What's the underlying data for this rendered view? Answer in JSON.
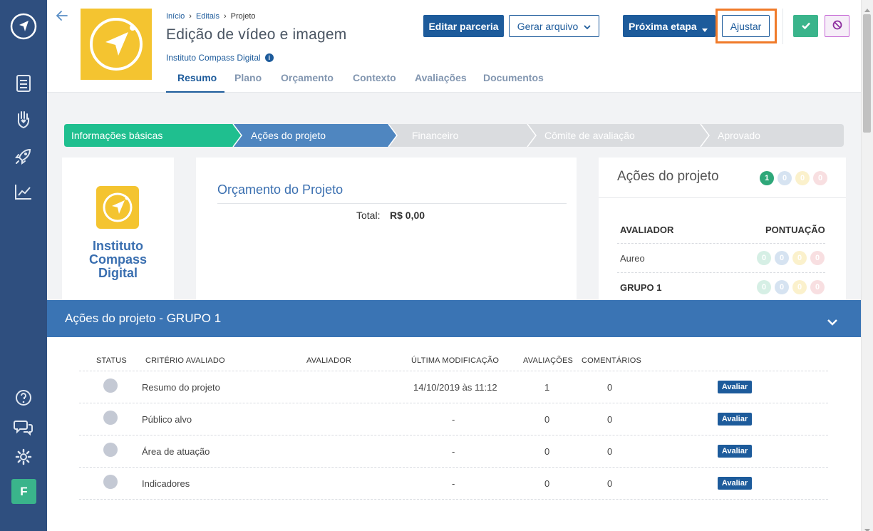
{
  "breadcrumb": {
    "home": "Início",
    "editais": "Editais",
    "current": "Projeto"
  },
  "sep": "›",
  "header": {
    "title": "Edição de vídeo e imagem",
    "organization": "Instituto Compass Digital",
    "info_icon": "info-icon",
    "back_icon": "arrow-left-icon"
  },
  "buttons": {
    "editar_parceria": "Editar parceria",
    "gerar_arquivo": "Gerar arquivo",
    "proxima_etapa": "Próxima etapa",
    "ajustar": "Ajustar"
  },
  "tabs": [
    "Resumo",
    "Plano",
    "Orçamento",
    "Contexto",
    "Avaliações",
    "Documentos"
  ],
  "steps": [
    "Informações básicas",
    "Ações do projeto",
    "Financeiro",
    "Cômite de avaliação",
    "Aprovado"
  ],
  "org_card": {
    "name_line1": "Instituto",
    "name_line2": "Compass",
    "name_line3": "Digital"
  },
  "budget": {
    "title": "Orçamento do Projeto",
    "total_label": "Total:",
    "total_value": "R$ 0,00"
  },
  "actions_card": {
    "title": "Ações do projeto",
    "badges": [
      "1",
      "0",
      "0",
      "0"
    ],
    "col_evaluator": "AVALIADOR",
    "col_score": "PONTUAÇÃO",
    "rows": [
      {
        "name": "Aureo",
        "scores": [
          "0",
          "0",
          "0",
          "0"
        ]
      },
      {
        "name": "GRUPO 1",
        "scores": [
          "0",
          "0",
          "0",
          "0"
        ]
      }
    ]
  },
  "group_panel": {
    "title": "Ações do projeto - GRUPO 1",
    "columns": [
      "STATUS",
      "CRITÉRIO AVALIADO",
      "AVALIADOR",
      "ÚLTIMA MODIFICAÇÃO",
      "AVALIAÇÕES",
      "COMENTÁRIOS"
    ],
    "action_label": "Avaliar",
    "rows": [
      {
        "criterion": "Resumo do projeto",
        "evaluator": "",
        "modified": "14/10/2019 às 11:12",
        "evaluations": "1",
        "comments": "0"
      },
      {
        "criterion": "Público alvo",
        "evaluator": "",
        "modified": "-",
        "evaluations": "0",
        "comments": "0"
      },
      {
        "criterion": "Área de atuação",
        "evaluator": "",
        "modified": "-",
        "evaluations": "0",
        "comments": "0"
      },
      {
        "criterion": "Indicadores",
        "evaluator": "",
        "modified": "-",
        "evaluations": "0",
        "comments": "0"
      }
    ]
  },
  "user_avatar": "F",
  "colors": {
    "rail": "#2f4f7f",
    "primary": "#1d5b9b",
    "teal": "#1fbf8f",
    "step_active": "#4f86c0",
    "logo_yellow": "#f4c430",
    "highlight": "#f07b2a"
  }
}
